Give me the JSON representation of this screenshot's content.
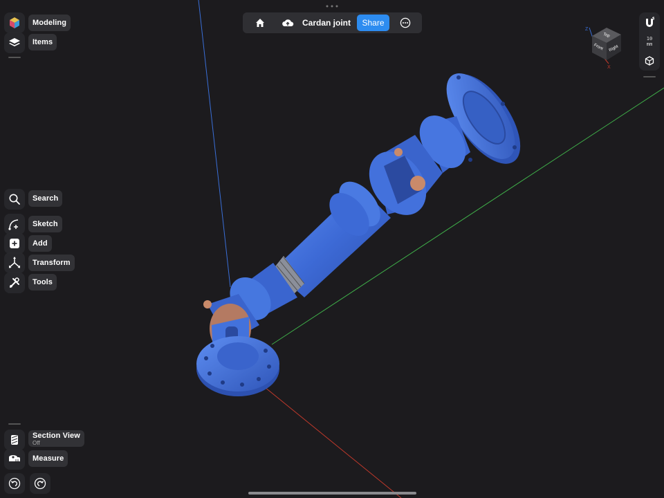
{
  "document": {
    "title": "Cardan joint",
    "share_label": "Share"
  },
  "left_toolbar": {
    "modeling_label": "Modeling",
    "items_label": "Items",
    "search_label": "Search",
    "sketch_label": "Sketch",
    "add_label": "Add",
    "transform_label": "Transform",
    "tools_label": "Tools",
    "section_view_label": "Section View",
    "section_view_state": "Off",
    "measure_label": "Measure"
  },
  "right_toolbar": {
    "scale_value": "10",
    "scale_unit": "mm"
  },
  "view_cube": {
    "top_label": "Top",
    "front_label": "Front",
    "right_label": "Right",
    "axis_z": "Z",
    "axis_x": "X"
  },
  "icons": [
    "home-icon",
    "cloud-upload-icon",
    "more-icon",
    "modeling-icon",
    "layers-icon",
    "search-icon",
    "sketch-icon",
    "add-icon",
    "transform-icon",
    "tools-icon",
    "section-view-icon",
    "measure-icon",
    "undo-icon",
    "redo-icon",
    "magnet-icon",
    "view-style-icon"
  ],
  "colors": {
    "background": "#1c1b1e",
    "model": "#3f6fd8",
    "accent": "#2d8cf0",
    "axis_x": "#c0392b",
    "axis_y": "#3fae49",
    "axis_z": "#3a6fd8",
    "bearing": "#c98a6a"
  }
}
